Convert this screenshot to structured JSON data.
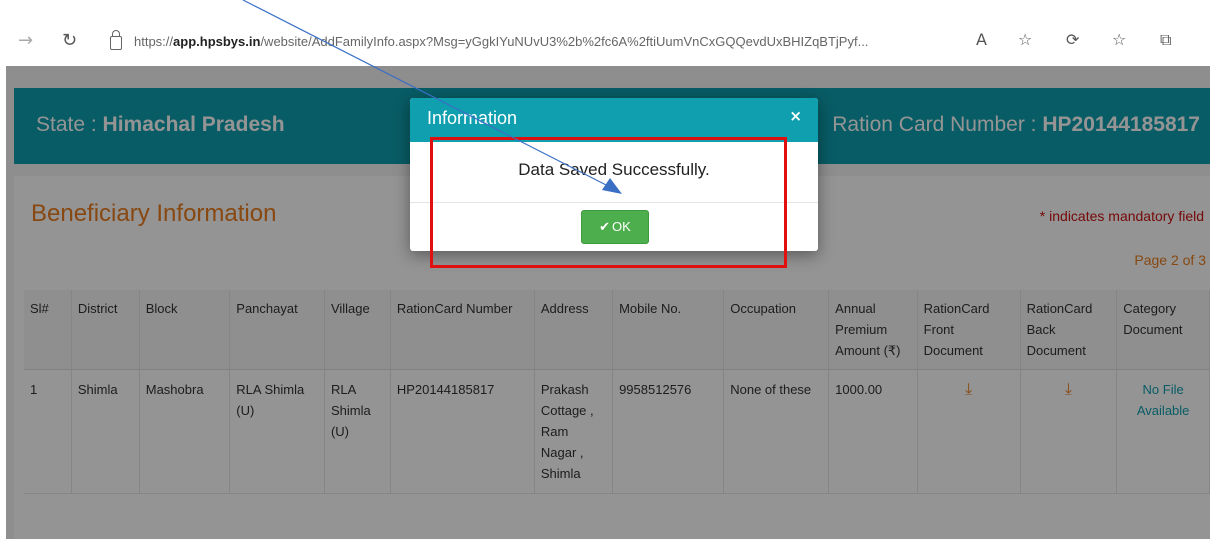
{
  "browser": {
    "url_prefix": "https://",
    "url_host": "app.hpsbys.in",
    "url_rest": "/website/AddFamilyInfo.aspx?Msg=yGgkIYuNUvU3%2b%2fc6A%2ftiUumVnCxGQQevdUxBHIZqBTjPyf...",
    "icons": [
      "forward-icon",
      "refresh-icon",
      "lock-icon",
      "read-aloud-icon",
      "favorite-add-icon",
      "extensions-icon",
      "favorites-icon",
      "collections-icon"
    ]
  },
  "banner": {
    "state_label": "State : ",
    "state_value": "Himachal Pradesh",
    "ration_label": "Ration Card Number : ",
    "ration_value": "HP20144185817"
  },
  "section": {
    "title": "Beneficiary Information",
    "mandatory_note": "* indicates mandatory field",
    "page_label": "Page 2 of 3"
  },
  "table": {
    "headers": [
      "Sl#",
      "District",
      "Block",
      "Panchayat",
      "Village",
      "RationCard Number",
      "Address",
      "Mobile No.",
      "Occupation",
      "Annual Premium Amount (₹)",
      "RationCard Front Document",
      "RationCard Back Document",
      "Category Document"
    ],
    "row": {
      "sl": "1",
      "district": "Shimla",
      "block": "Mashobra",
      "panchayat": "RLA Shimla (U)",
      "village": "RLA Shimla (U)",
      "ration_no": "HP20144185817",
      "address": "Prakash Cottage , Ram Nagar , Shimla",
      "mobile": "9958512576",
      "occupation": "None of these",
      "premium": "1000.00",
      "category_doc": "No File Available"
    }
  },
  "modal": {
    "title": "Information",
    "close": "×",
    "message": "Data Saved Successfully.",
    "ok_label": "OK"
  },
  "colors": {
    "teal": "#0f9fae",
    "orange": "#e87d1e",
    "ok_green": "#4cae4c",
    "highlight_red": "#e01010"
  }
}
